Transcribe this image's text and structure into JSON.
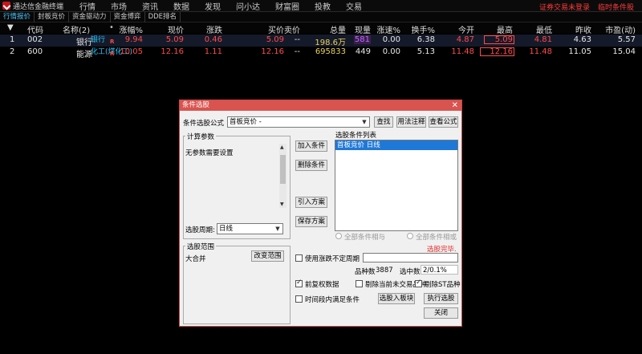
{
  "app": {
    "name": "通达信金融终端",
    "menu": [
      "行情",
      "市场",
      "资讯",
      "数据",
      "发现",
      "问小达",
      "财富圈",
      "投教",
      "交易"
    ],
    "right_links": [
      "证券交易未登录",
      "临时条件股"
    ]
  },
  "tabs": [
    "行情报价",
    "封板竞价",
    "资金驱动力",
    "资金博弈",
    "DDE排名"
  ],
  "grid": {
    "sort_indicator": "▼",
    "columns": [
      "代码",
      "名称(2)",
      "•",
      "涨幅%",
      "现价",
      "涨跌",
      "买价",
      "卖价",
      "总量",
      "现量",
      "涨速%",
      "换手%",
      "今开",
      "最高",
      "最低",
      "昨收",
      "市盈(动)"
    ],
    "rows": [
      {
        "num": "1",
        "code": "002",
        "name": "银行",
        "tag": "银行",
        "flag": "R",
        "pct": "9.94",
        "price": "5.09",
        "change": "0.46",
        "bid": "5.09",
        "ask": "--",
        "volume": "198.6万",
        "cur_vol": "581",
        "speed": "0.00",
        "turnover": "6.38",
        "open": "4.87",
        "high": "5.09",
        "low": "4.81",
        "prev_close": "4.63",
        "pe": "5.57"
      },
      {
        "num": "2",
        "code": "600",
        "name": "能源",
        "tag": "化工(煤化工)",
        "flag": "R",
        "pct": "10.05",
        "price": "12.16",
        "change": "1.11",
        "bid": "12.16",
        "ask": "--",
        "volume": "695833",
        "cur_vol": "449",
        "speed": "0.00",
        "turnover": "5.13",
        "open": "11.48",
        "high": "12.16",
        "low": "11.48",
        "prev_close": "11.05",
        "pe": "15.04"
      }
    ]
  },
  "dialog": {
    "title": "条件选股",
    "close_glyph": "✕",
    "formula_label": "条件选股公式",
    "formula_value": "首板竞价  -",
    "find_button": "查找",
    "usage_button": "用法注释",
    "view_formula_button": "查看公式",
    "params_group": "计算参数",
    "params_text": "无参数需要设置",
    "add_condition_button": "加入条件",
    "delete_condition_button": "删除条件",
    "import_plan_button": "引入方案",
    "save_plan_button": "保存方案",
    "cond_list_label": "选股条件列表",
    "cond_list_items": [
      "首板竞价  日线"
    ],
    "period_label": "选股周期:",
    "period_value": "日线",
    "radio_all": "全部条件相与",
    "radio_or": "全部条件相或",
    "status_text": "选股完毕.",
    "range_group": "选股范围",
    "range_value": "大合并",
    "change_range_button": "改变范围",
    "use_period_label": "使用涨跌不定周期",
    "count_label": "品种数",
    "count_value": "3887",
    "selected_label": "选中数",
    "selected_value": "2/0.1%",
    "pre_adjust_label": "前复权数据",
    "remove_untraded_label": "剔除当前未交易品种",
    "remove_st_label": "剔除ST品种",
    "time_period_label": "时间段内满足条件",
    "to_sector_button": "选股入板块",
    "execute_button": "执行选股",
    "close_button": "关闭"
  }
}
